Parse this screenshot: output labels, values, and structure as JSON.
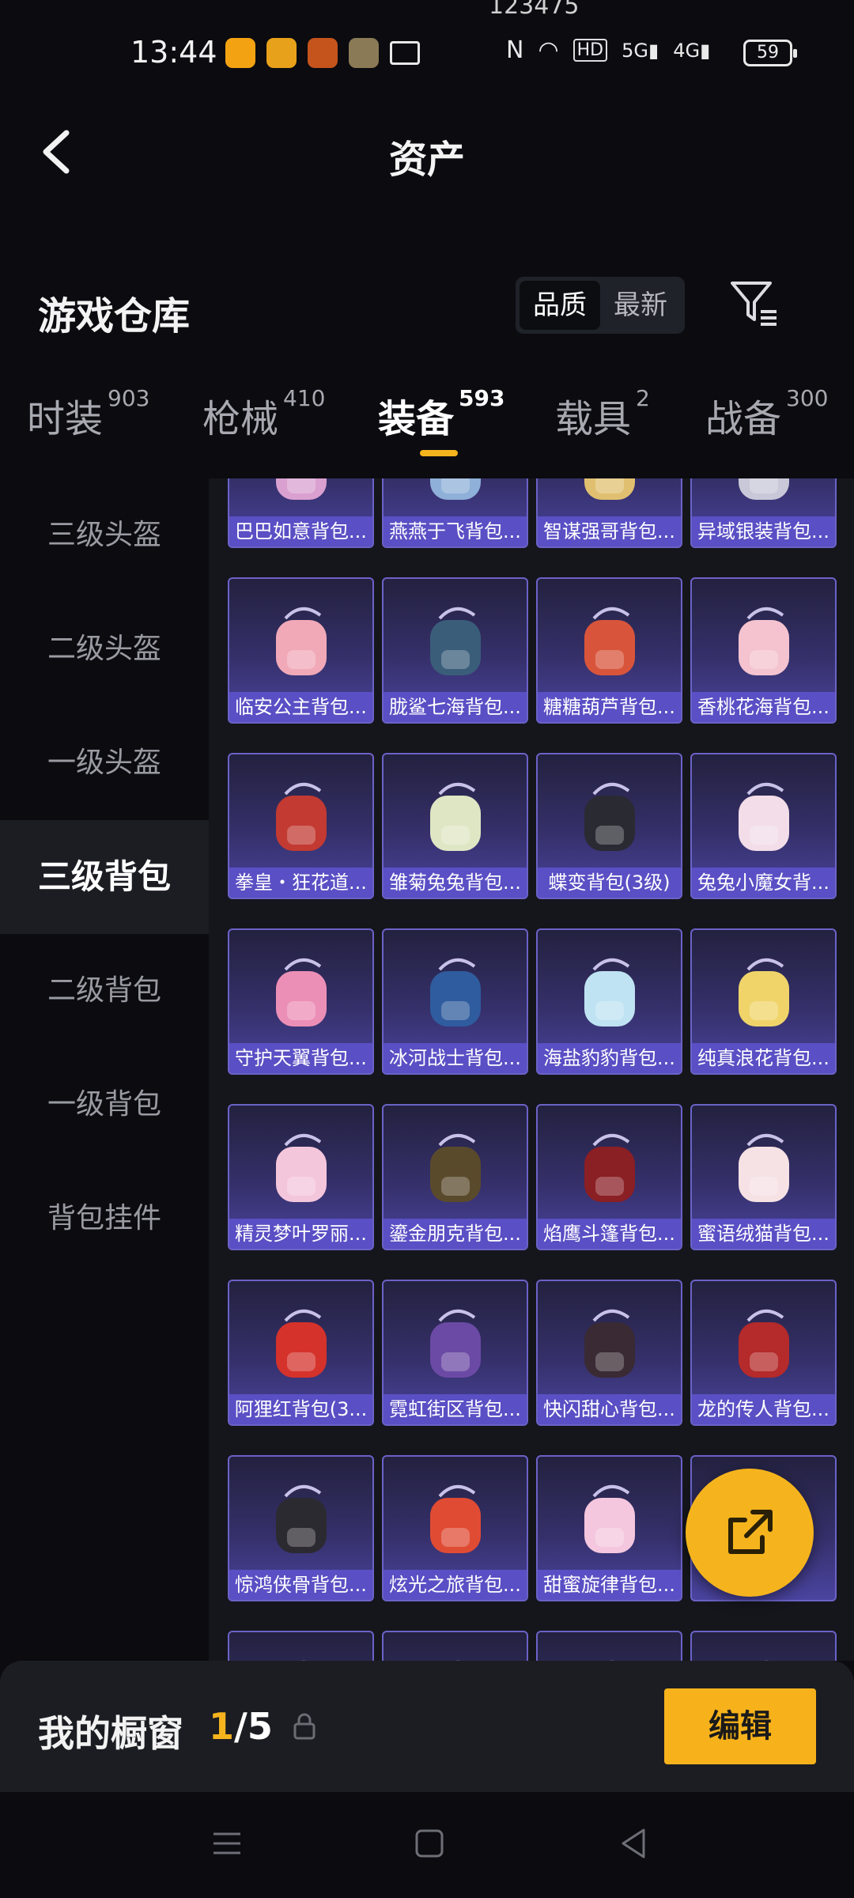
{
  "status_bar": {
    "time": "13:44",
    "carrier_text": "123475",
    "battery": "59",
    "app_icon_colors": [
      "#f3a312",
      "#e8a11a",
      "#c4541c",
      "#8a7a55"
    ],
    "icons": [
      "notification-mail-icon",
      "nfc-icon",
      "wifi-icon",
      "hd-icon",
      "signal-5g-icon",
      "signal-4g-icon",
      "battery-icon"
    ]
  },
  "header": {
    "title": "资产",
    "back_icon": "chevron-left-icon"
  },
  "warehouse": {
    "title": "游戏仓库",
    "sort_options": [
      "品质",
      "最新"
    ],
    "filter_icon": "filter-icon"
  },
  "tabs": [
    {
      "label": "时装",
      "count": "903"
    },
    {
      "label": "枪械",
      "count": "410"
    },
    {
      "label": "装备",
      "count": "593"
    },
    {
      "label": "载具",
      "count": "2"
    },
    {
      "label": "战备",
      "count": "300"
    }
  ],
  "sidebar": [
    {
      "label": "三级头盔"
    },
    {
      "label": "二级头盔"
    },
    {
      "label": "一级头盔"
    },
    {
      "label": "三级背包"
    },
    {
      "label": "二级背包"
    },
    {
      "label": "一级背包"
    },
    {
      "label": "背包挂件"
    }
  ],
  "items": [
    {
      "label": "巴巴如意背包...",
      "color": "#d9a0d0"
    },
    {
      "label": "燕燕于飞背包...",
      "color": "#8fb0d8"
    },
    {
      "label": "智谋强哥背包...",
      "color": "#e0c070"
    },
    {
      "label": "异域银装背包...",
      "color": "#c8c8d8"
    },
    {
      "label": "临安公主背包...",
      "color": "#f1a9b8"
    },
    {
      "label": "胧鲨七海背包...",
      "color": "#3a5d7a"
    },
    {
      "label": "糖糖葫芦背包...",
      "color": "#d8553b"
    },
    {
      "label": "香桃花海背包...",
      "color": "#f4c3cf"
    },
    {
      "label": "拳皇・狂花道...",
      "color": "#c23a32"
    },
    {
      "label": "雏菊兔兔背包...",
      "color": "#dfe6c4"
    },
    {
      "label": "蝶变背包(3级)",
      "color": "#2a2a33"
    },
    {
      "label": "兔兔小魔女背...",
      "color": "#f2dde8"
    },
    {
      "label": "守护天翼背包...",
      "color": "#ec8fb6"
    },
    {
      "label": "冰河战士背包...",
      "color": "#2f5c9e"
    },
    {
      "label": "海盐豹豹背包...",
      "color": "#bfe3f2"
    },
    {
      "label": "纯真浪花背包...",
      "color": "#f0d46a"
    },
    {
      "label": "精灵梦叶罗丽...",
      "color": "#f4c6dc"
    },
    {
      "label": "鎏金朋克背包...",
      "color": "#5a4a2c"
    },
    {
      "label": "焰鹰斗篷背包...",
      "color": "#8a1f24"
    },
    {
      "label": "蜜语绒猫背包...",
      "color": "#f6e1e4"
    },
    {
      "label": "阿狸红背包(3...",
      "color": "#d5322b"
    },
    {
      "label": "霓虹街区背包...",
      "color": "#6b4aa5"
    },
    {
      "label": "快闪甜心背包...",
      "color": "#3a2a33"
    },
    {
      "label": "龙的传人背包...",
      "color": "#b52a2a"
    },
    {
      "label": "惊鸿侠骨背包...",
      "color": "#2c2a31"
    },
    {
      "label": "炫光之旅背包...",
      "color": "#e04b34"
    },
    {
      "label": "甜蜜旋律背包...",
      "color": "#f4c7de"
    },
    {
      "label": "",
      "color": "#2a2a33"
    },
    {
      "label": "",
      "color": "#dfe8e4"
    },
    {
      "label": "",
      "color": "#7a4fc7"
    },
    {
      "label": "",
      "color": "#c72c2c"
    },
    {
      "label": "",
      "color": "#eef0f8"
    }
  ],
  "fab": {
    "icon": "share-export-icon",
    "color": "#f5b41d"
  },
  "showcase": {
    "label": "我的橱窗",
    "current": "1",
    "separator": "/",
    "total": "5",
    "lock_icon": "lock-icon",
    "edit_label": "编辑"
  },
  "navbar": {
    "icons": [
      "menu-icon",
      "home-square-icon",
      "back-triangle-icon"
    ]
  },
  "colors": {
    "accent": "#f5b41d",
    "card_label_bg": "#5a4fc4",
    "background": "#0b0b10"
  }
}
